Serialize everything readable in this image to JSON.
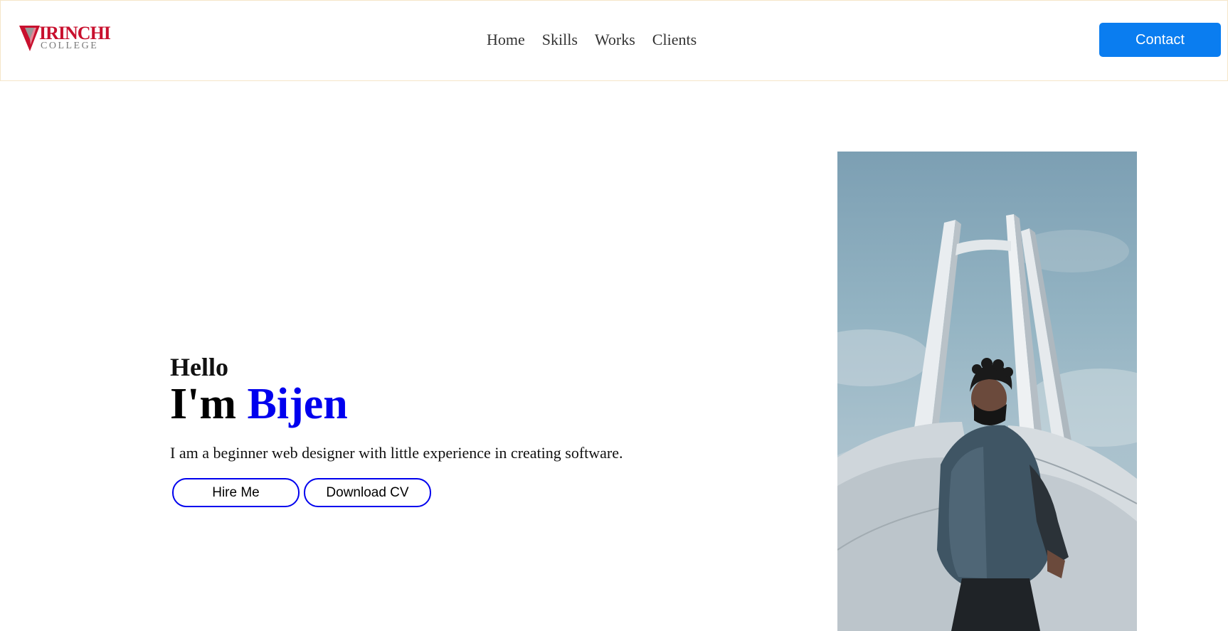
{
  "header": {
    "logo": {
      "main": "IRINCHI",
      "sub": "COLLEGE",
      "brand_color": "#c8102e"
    },
    "nav": [
      {
        "label": "Home"
      },
      {
        "label": "Skills"
      },
      {
        "label": "Works"
      },
      {
        "label": "Clients"
      }
    ],
    "contact_label": "Contact",
    "accent_color": "#0a7df0"
  },
  "hero": {
    "greeting": "Hello",
    "intro_prefix": "I'm ",
    "name": "Bijen",
    "name_color": "#0000ee",
    "description": "I am a beginner web designer with little experience in creating software.",
    "buttons": {
      "hire": "Hire Me",
      "cv": "Download CV"
    }
  },
  "photo": {
    "icon": "person-photo"
  }
}
